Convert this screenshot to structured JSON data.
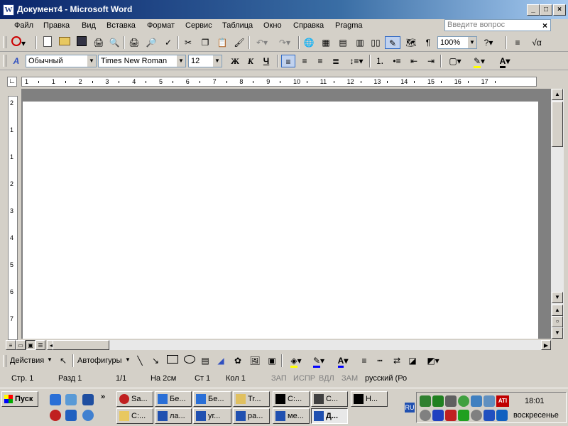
{
  "window": {
    "title": "Документ4 - Microsoft Word",
    "app_icon_letter": "W",
    "buttons": {
      "minimize": "_",
      "maximize": "□",
      "close": "×"
    }
  },
  "menu": {
    "items": [
      "Файл",
      "Правка",
      "Вид",
      "Вставка",
      "Формат",
      "Сервис",
      "Таблица",
      "Окно",
      "Справка",
      "Pragma"
    ],
    "ask_placeholder": "Введите вопрос",
    "close_doc": "×"
  },
  "standard_toolbar": {
    "zoom": "100%"
  },
  "formatting_toolbar": {
    "style": "Обычный",
    "font": "Times New Roman",
    "size": "12",
    "bold": "Ж",
    "italic": "К",
    "underline": "Ч"
  },
  "ruler": {
    "h_labels": [
      "1",
      "1",
      "2",
      "3",
      "4",
      "5",
      "6",
      "7",
      "8",
      "9",
      "10",
      "11",
      "12",
      "13",
      "14",
      "15",
      "16",
      "17"
    ],
    "v_labels": [
      "2",
      "1",
      "1",
      "2",
      "3",
      "4",
      "5",
      "6",
      "7"
    ]
  },
  "drawing_toolbar": {
    "actions": "Действия",
    "autoshapes": "Автофигуры"
  },
  "status_bar": {
    "page": "Стр. 1",
    "section": "Разд 1",
    "pages": "1/1",
    "at": "На 2см",
    "line": "Ст 1",
    "col": "Кол 1",
    "rec": "ЗАП",
    "trk": "ИСПР",
    "ext": "ВДЛ",
    "ovr": "ЗАМ",
    "lang": "русский (Ро"
  },
  "taskbar": {
    "start": "Пуск",
    "row1": [
      "Sa...",
      "Бе...",
      "Бе...",
      "Tr...",
      "C:...",
      "С...",
      "H..."
    ],
    "row2": [
      "C:...",
      "ла...",
      "уг...",
      "ра...",
      "ме...",
      "Д..."
    ],
    "lang_indicator": "RU",
    "clock": "18:01",
    "day": "воскресенье",
    "ati": "ATI"
  }
}
